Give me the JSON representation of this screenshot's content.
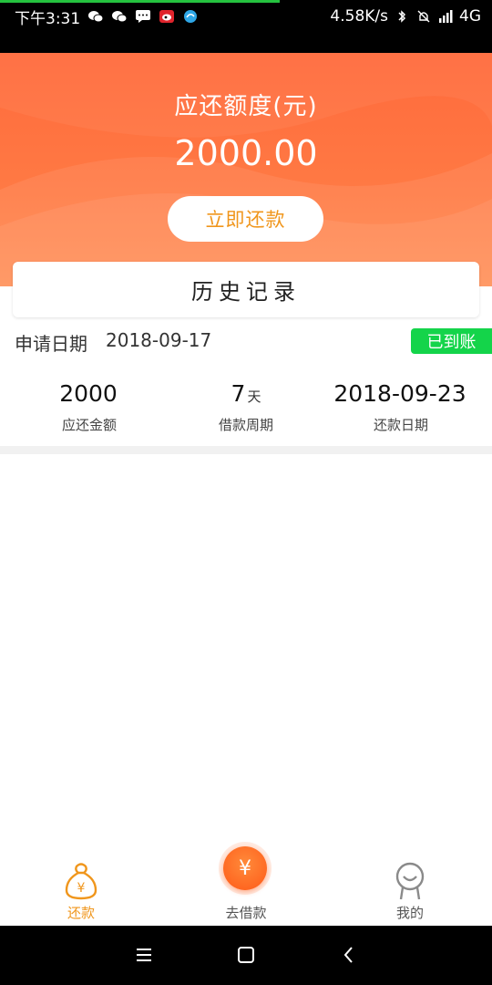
{
  "status_bar": {
    "time": "下午3:31",
    "net_speed": "4.58K/s",
    "network": "4G"
  },
  "header": {
    "title": "应还额度(元)",
    "amount": "2000.00",
    "repay_button_label": "立即还款"
  },
  "history_tab": {
    "label": "历史记录"
  },
  "record": {
    "date_label": "申请日期",
    "date_value": "2018-09-17",
    "status": "已到账",
    "stats": [
      {
        "value": "2000",
        "unit": "",
        "label": "应还金额"
      },
      {
        "value": "7",
        "unit": "天",
        "label": "借款周期"
      },
      {
        "value": "2018-09-23",
        "unit": "",
        "label": "还款日期"
      }
    ]
  },
  "bottom_nav": {
    "items": [
      {
        "label": "还款",
        "icon": "money-bag-icon",
        "active": true
      },
      {
        "label": "去借款",
        "icon": "yen-circle-icon",
        "active": false
      },
      {
        "label": "我的",
        "icon": "user-face-icon",
        "active": false
      }
    ],
    "center_symbol": "¥",
    "bag_symbol": "¥"
  },
  "colors": {
    "brand_orange": "#ff6a3c",
    "accent_text": "#f0961c",
    "badge_green": "#14d44a",
    "inactive_gray": "#888888"
  }
}
